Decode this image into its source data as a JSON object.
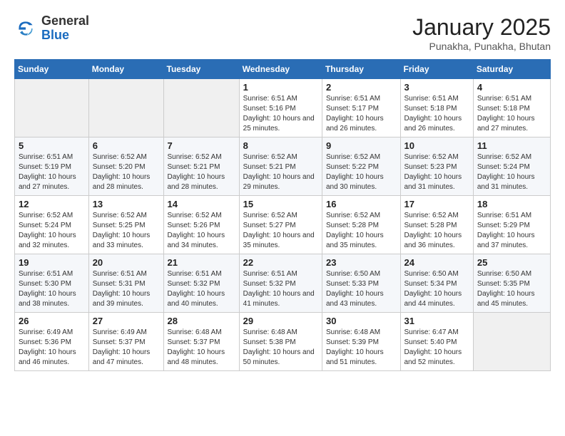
{
  "header": {
    "logo_line1": "General",
    "logo_line2": "Blue",
    "title": "January 2025",
    "subtitle": "Punakha, Punakha, Bhutan"
  },
  "days_of_week": [
    "Sunday",
    "Monday",
    "Tuesday",
    "Wednesday",
    "Thursday",
    "Friday",
    "Saturday"
  ],
  "weeks": [
    [
      {
        "day": "",
        "sunrise": "",
        "sunset": "",
        "daylight": ""
      },
      {
        "day": "",
        "sunrise": "",
        "sunset": "",
        "daylight": ""
      },
      {
        "day": "",
        "sunrise": "",
        "sunset": "",
        "daylight": ""
      },
      {
        "day": "1",
        "sunrise": "Sunrise: 6:51 AM",
        "sunset": "Sunset: 5:16 PM",
        "daylight": "Daylight: 10 hours and 25 minutes."
      },
      {
        "day": "2",
        "sunrise": "Sunrise: 6:51 AM",
        "sunset": "Sunset: 5:17 PM",
        "daylight": "Daylight: 10 hours and 26 minutes."
      },
      {
        "day": "3",
        "sunrise": "Sunrise: 6:51 AM",
        "sunset": "Sunset: 5:18 PM",
        "daylight": "Daylight: 10 hours and 26 minutes."
      },
      {
        "day": "4",
        "sunrise": "Sunrise: 6:51 AM",
        "sunset": "Sunset: 5:18 PM",
        "daylight": "Daylight: 10 hours and 27 minutes."
      }
    ],
    [
      {
        "day": "5",
        "sunrise": "Sunrise: 6:51 AM",
        "sunset": "Sunset: 5:19 PM",
        "daylight": "Daylight: 10 hours and 27 minutes."
      },
      {
        "day": "6",
        "sunrise": "Sunrise: 6:52 AM",
        "sunset": "Sunset: 5:20 PM",
        "daylight": "Daylight: 10 hours and 28 minutes."
      },
      {
        "day": "7",
        "sunrise": "Sunrise: 6:52 AM",
        "sunset": "Sunset: 5:21 PM",
        "daylight": "Daylight: 10 hours and 28 minutes."
      },
      {
        "day": "8",
        "sunrise": "Sunrise: 6:52 AM",
        "sunset": "Sunset: 5:21 PM",
        "daylight": "Daylight: 10 hours and 29 minutes."
      },
      {
        "day": "9",
        "sunrise": "Sunrise: 6:52 AM",
        "sunset": "Sunset: 5:22 PM",
        "daylight": "Daylight: 10 hours and 30 minutes."
      },
      {
        "day": "10",
        "sunrise": "Sunrise: 6:52 AM",
        "sunset": "Sunset: 5:23 PM",
        "daylight": "Daylight: 10 hours and 31 minutes."
      },
      {
        "day": "11",
        "sunrise": "Sunrise: 6:52 AM",
        "sunset": "Sunset: 5:24 PM",
        "daylight": "Daylight: 10 hours and 31 minutes."
      }
    ],
    [
      {
        "day": "12",
        "sunrise": "Sunrise: 6:52 AM",
        "sunset": "Sunset: 5:24 PM",
        "daylight": "Daylight: 10 hours and 32 minutes."
      },
      {
        "day": "13",
        "sunrise": "Sunrise: 6:52 AM",
        "sunset": "Sunset: 5:25 PM",
        "daylight": "Daylight: 10 hours and 33 minutes."
      },
      {
        "day": "14",
        "sunrise": "Sunrise: 6:52 AM",
        "sunset": "Sunset: 5:26 PM",
        "daylight": "Daylight: 10 hours and 34 minutes."
      },
      {
        "day": "15",
        "sunrise": "Sunrise: 6:52 AM",
        "sunset": "Sunset: 5:27 PM",
        "daylight": "Daylight: 10 hours and 35 minutes."
      },
      {
        "day": "16",
        "sunrise": "Sunrise: 6:52 AM",
        "sunset": "Sunset: 5:28 PM",
        "daylight": "Daylight: 10 hours and 35 minutes."
      },
      {
        "day": "17",
        "sunrise": "Sunrise: 6:52 AM",
        "sunset": "Sunset: 5:28 PM",
        "daylight": "Daylight: 10 hours and 36 minutes."
      },
      {
        "day": "18",
        "sunrise": "Sunrise: 6:51 AM",
        "sunset": "Sunset: 5:29 PM",
        "daylight": "Daylight: 10 hours and 37 minutes."
      }
    ],
    [
      {
        "day": "19",
        "sunrise": "Sunrise: 6:51 AM",
        "sunset": "Sunset: 5:30 PM",
        "daylight": "Daylight: 10 hours and 38 minutes."
      },
      {
        "day": "20",
        "sunrise": "Sunrise: 6:51 AM",
        "sunset": "Sunset: 5:31 PM",
        "daylight": "Daylight: 10 hours and 39 minutes."
      },
      {
        "day": "21",
        "sunrise": "Sunrise: 6:51 AM",
        "sunset": "Sunset: 5:32 PM",
        "daylight": "Daylight: 10 hours and 40 minutes."
      },
      {
        "day": "22",
        "sunrise": "Sunrise: 6:51 AM",
        "sunset": "Sunset: 5:32 PM",
        "daylight": "Daylight: 10 hours and 41 minutes."
      },
      {
        "day": "23",
        "sunrise": "Sunrise: 6:50 AM",
        "sunset": "Sunset: 5:33 PM",
        "daylight": "Daylight: 10 hours and 43 minutes."
      },
      {
        "day": "24",
        "sunrise": "Sunrise: 6:50 AM",
        "sunset": "Sunset: 5:34 PM",
        "daylight": "Daylight: 10 hours and 44 minutes."
      },
      {
        "day": "25",
        "sunrise": "Sunrise: 6:50 AM",
        "sunset": "Sunset: 5:35 PM",
        "daylight": "Daylight: 10 hours and 45 minutes."
      }
    ],
    [
      {
        "day": "26",
        "sunrise": "Sunrise: 6:49 AM",
        "sunset": "Sunset: 5:36 PM",
        "daylight": "Daylight: 10 hours and 46 minutes."
      },
      {
        "day": "27",
        "sunrise": "Sunrise: 6:49 AM",
        "sunset": "Sunset: 5:37 PM",
        "daylight": "Daylight: 10 hours and 47 minutes."
      },
      {
        "day": "28",
        "sunrise": "Sunrise: 6:48 AM",
        "sunset": "Sunset: 5:37 PM",
        "daylight": "Daylight: 10 hours and 48 minutes."
      },
      {
        "day": "29",
        "sunrise": "Sunrise: 6:48 AM",
        "sunset": "Sunset: 5:38 PM",
        "daylight": "Daylight: 10 hours and 50 minutes."
      },
      {
        "day": "30",
        "sunrise": "Sunrise: 6:48 AM",
        "sunset": "Sunset: 5:39 PM",
        "daylight": "Daylight: 10 hours and 51 minutes."
      },
      {
        "day": "31",
        "sunrise": "Sunrise: 6:47 AM",
        "sunset": "Sunset: 5:40 PM",
        "daylight": "Daylight: 10 hours and 52 minutes."
      },
      {
        "day": "",
        "sunrise": "",
        "sunset": "",
        "daylight": ""
      }
    ]
  ]
}
